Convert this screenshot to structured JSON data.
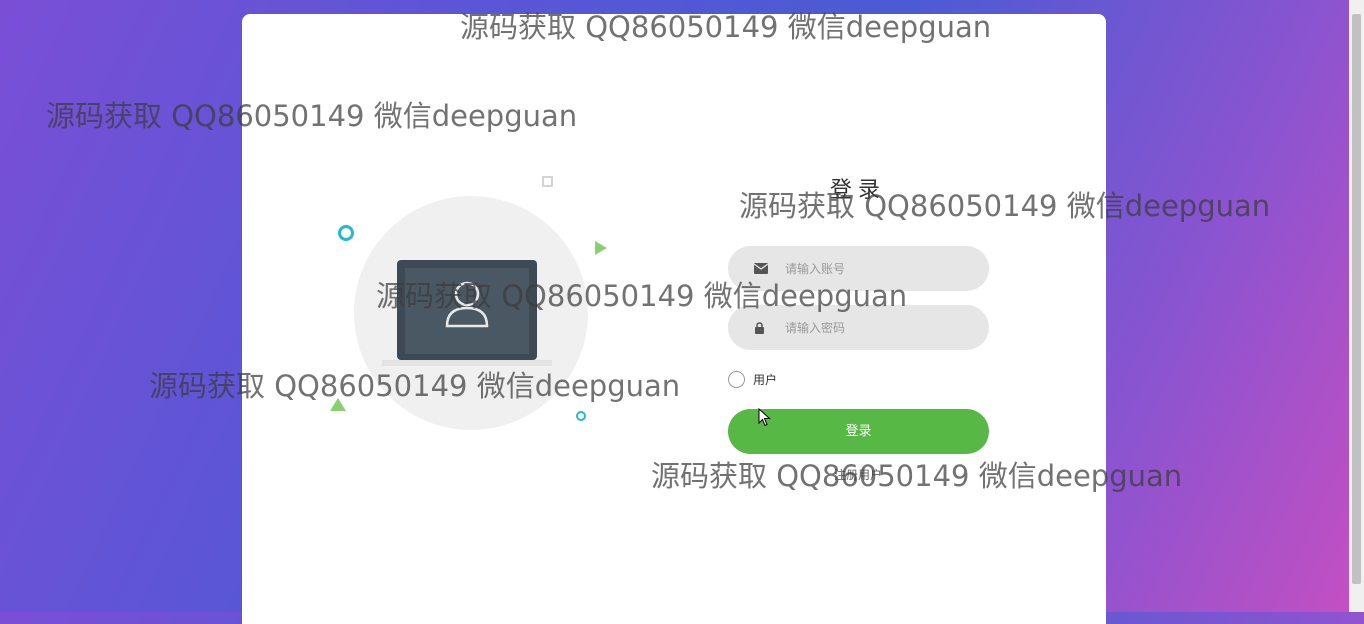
{
  "login": {
    "title": "登录",
    "account_placeholder": "请输入账号",
    "password_placeholder": "请输入密码",
    "role_label": "用户",
    "submit_label": "登录",
    "register_label": "注册用户"
  },
  "icons": {
    "account": "envelope-icon",
    "password": "lock-icon"
  },
  "watermark": "源码获取 QQ86050149 微信deepguan",
  "colors": {
    "accent": "#57b846",
    "field_bg": "#e6e6e6",
    "background_gradient": [
      "#7a4fd6",
      "#4a5bd4",
      "#c54fc2"
    ]
  }
}
